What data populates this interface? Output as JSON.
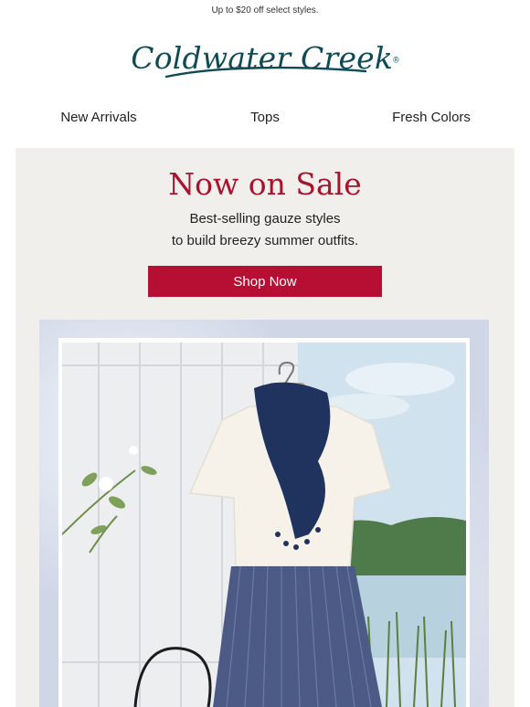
{
  "preheader": "Up to $20 off select styles.",
  "brand": {
    "name": "Coldwater Creek",
    "mark": "®",
    "color": "#0f4a55"
  },
  "nav": [
    {
      "label": "New Arrivals"
    },
    {
      "label": "Tops"
    },
    {
      "label": "Fresh Colors"
    }
  ],
  "hero": {
    "title": "Now on Sale",
    "subtitle_line1": "Best-selling gauze styles",
    "subtitle_line2": "to build breezy summer outfits.",
    "cta_label": "Shop Now",
    "accent_color": "#b70e33",
    "background_color": "#f0efeb"
  },
  "product_image": {
    "icon": "product-photo",
    "items": [
      "white gauze top",
      "navy scarf",
      "striped navy skirt"
    ]
  }
}
